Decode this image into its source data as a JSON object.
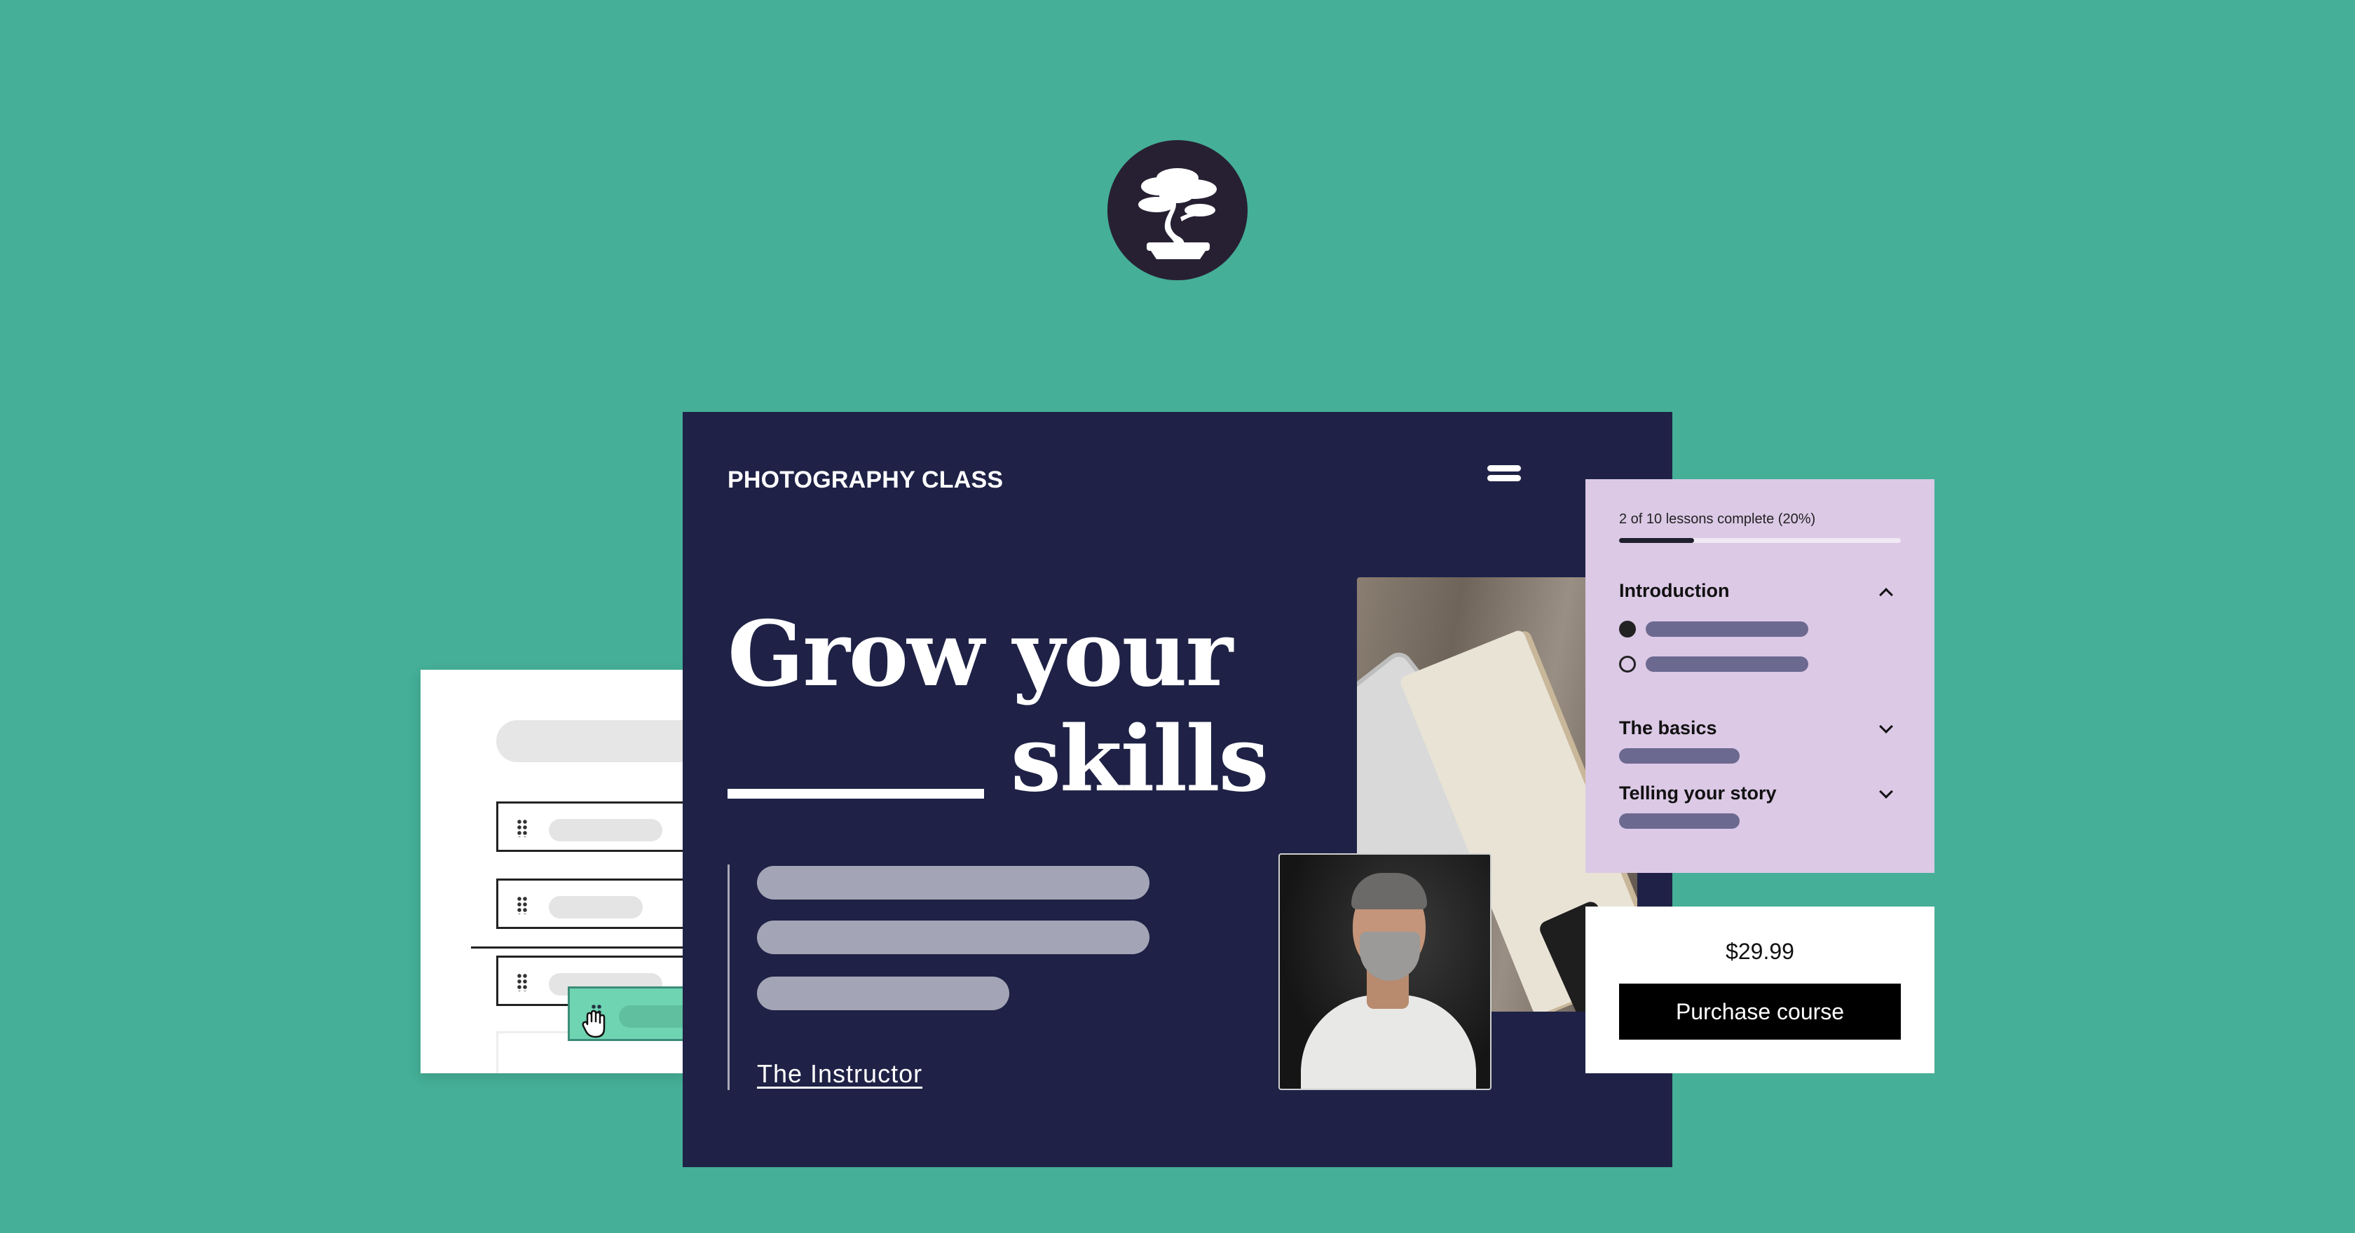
{
  "colors": {
    "background": "#45af97",
    "logo_circle": "#272033",
    "main_bg": "#1f2246",
    "lessons_bg": "#dcc9e6",
    "drag_highlight": "#6fd4b1",
    "button_bg": "#000000"
  },
  "logo": {
    "icon": "bonsai-tree-icon"
  },
  "course_page": {
    "site_title": "PHOTOGRAPHY CLASS",
    "menu_icon": "hamburger-menu-icon",
    "headline_line1": "Grow your",
    "headline_line2": "skills",
    "instructor_link": "The Instructor"
  },
  "lessons_panel": {
    "progress_text": "2 of 10 lessons complete (20%)",
    "progress_fraction": 0.2,
    "sections": [
      {
        "title": "Introduction",
        "state": "expanded"
      },
      {
        "title": "The basics",
        "state": "collapsed"
      },
      {
        "title": "Telling your story",
        "state": "collapsed"
      }
    ]
  },
  "purchase": {
    "price": "$29.99",
    "button_label": "Purchase course"
  },
  "builder": {
    "drag_cursor_icon": "grab-hand-icon"
  }
}
